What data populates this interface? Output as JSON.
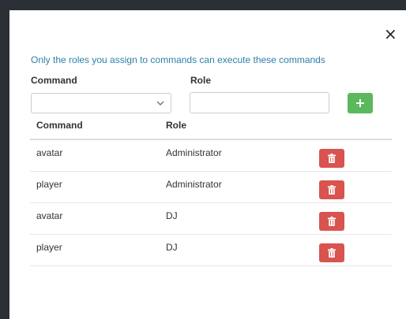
{
  "modal": {
    "close_glyph": "×",
    "notice": "Only the roles you assign to commands can execute these commands",
    "form": {
      "command_label": "Command",
      "role_label": "Role",
      "command_select_value": "",
      "role_input_value": "",
      "add_glyph": "+"
    },
    "table": {
      "headers": {
        "command": "Command",
        "role": "Role"
      },
      "rows": [
        {
          "command": "avatar",
          "role": "Administrator"
        },
        {
          "command": "player",
          "role": "Administrator"
        },
        {
          "command": "avatar",
          "role": "DJ"
        },
        {
          "command": "player",
          "role": "DJ"
        }
      ]
    }
  },
  "colors": {
    "backdrop": "#2b2f36",
    "notice_text": "#2e7fa8",
    "add_button": "#5cb85c",
    "delete_button": "#d9534f"
  },
  "icons": {
    "close": "close-icon",
    "chevron": "chevron-down-icon",
    "add": "plus-icon",
    "delete": "trash-icon"
  }
}
